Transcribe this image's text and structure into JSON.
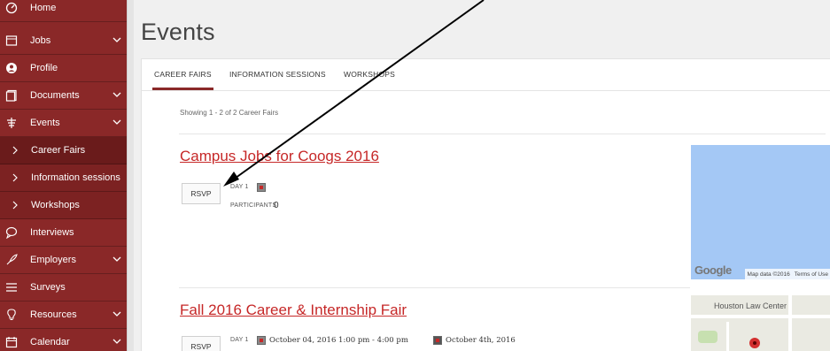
{
  "sidebar": {
    "items": [
      {
        "label": "Home",
        "icon": "dashboard-icon",
        "chevron": false
      },
      {
        "label": "Jobs",
        "icon": "briefcase-icon",
        "chevron": true
      },
      {
        "label": "Profile",
        "icon": "profile-icon",
        "chevron": false
      },
      {
        "label": "Documents",
        "icon": "documents-icon",
        "chevron": true
      },
      {
        "label": "Events",
        "icon": "events-icon",
        "chevron": true
      },
      {
        "label": "Career Fairs",
        "icon": "chevron-right-icon",
        "chevron": false
      },
      {
        "label": "Information sessions",
        "icon": "chevron-right-icon",
        "chevron": false
      },
      {
        "label": "Workshops",
        "icon": "chevron-right-icon",
        "chevron": false
      },
      {
        "label": "Interviews",
        "icon": "interviews-icon",
        "chevron": false
      },
      {
        "label": "Employers",
        "icon": "rocket-icon",
        "chevron": true
      },
      {
        "label": "Surveys",
        "icon": "list-icon",
        "chevron": false
      },
      {
        "label": "Resources",
        "icon": "lightbulb-icon",
        "chevron": true
      },
      {
        "label": "Calendar",
        "icon": "calendar-icon",
        "chevron": true
      }
    ]
  },
  "page": {
    "title": "Events"
  },
  "tabs": [
    {
      "label": "CAREER FAIRS",
      "active": true
    },
    {
      "label": "INFORMATION SESSIONS",
      "active": false
    },
    {
      "label": "WORKSHOPS",
      "active": false
    }
  ],
  "list": {
    "showing": "Showing 1 - 2 of 2 Career Fairs"
  },
  "events": [
    {
      "title": "Campus Jobs for Coogs 2016",
      "rsvp_label": "RSVP",
      "day_label": "DAY 1",
      "participants_label": "PARTICIPANTS",
      "participants_count": "0",
      "map": {
        "brand": "Google",
        "attribution": "Map data ©2016",
        "terms": "Terms of Use"
      }
    },
    {
      "title": "Fall 2016 Career & Internship Fair",
      "rsvp_label": "RSVP",
      "day_label": "DAY 1",
      "datetime": "October 04, 2016 1:00 pm - 4:00 pm",
      "location_date": "October 4th, 2016",
      "map": {
        "place": "Houston Law Center"
      }
    }
  ],
  "colors": {
    "sidebar": "#8a2828",
    "accent": "#c62828"
  }
}
